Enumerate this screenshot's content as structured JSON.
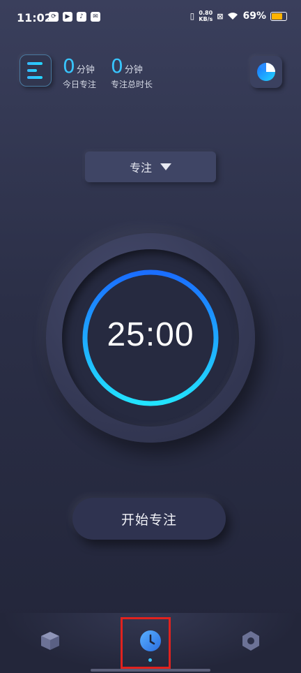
{
  "status_bar": {
    "time": "11:02",
    "network_speed": "0.80",
    "network_unit": "KB/s",
    "battery": "69%",
    "app_icons": [
      "sync-icon",
      "play-store-icon",
      "tiktok-icon",
      "mail-icon"
    ]
  },
  "header": {
    "today_focus": {
      "value": "0",
      "unit": "分钟",
      "label": "今日专注"
    },
    "total_focus": {
      "value": "0",
      "unit": "分钟",
      "label": "专注总时长"
    }
  },
  "mode_selector": {
    "selected": "专注"
  },
  "timer": {
    "display": "25:00",
    "progress": 1.0
  },
  "start_button": {
    "label": "开始专注"
  },
  "bottom_nav": {
    "items": [
      "cube-icon",
      "clock-icon",
      "settings-hex-icon"
    ],
    "active_index": 1
  },
  "colors": {
    "accent": "#38c6ff",
    "ring_start": "#1a6dff",
    "ring_end": "#22e3ff",
    "highlight": "#e0221e"
  }
}
